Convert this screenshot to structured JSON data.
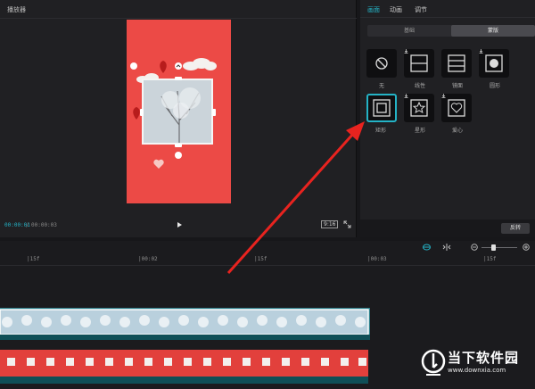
{
  "player": {
    "title": "播放器",
    "current_time": "00:00:01",
    "separator": "/",
    "total_time": "00:00:03",
    "ratio": "9:16"
  },
  "props": {
    "tabs": [
      {
        "label": "画面",
        "active": true
      },
      {
        "label": "动画",
        "active": false
      },
      {
        "label": "调节",
        "active": false
      }
    ],
    "segments": [
      {
        "label": "基础",
        "active": false
      },
      {
        "label": "蒙版",
        "active": true
      }
    ],
    "masks": [
      {
        "label": "无",
        "icon": "none-icon",
        "selected": false
      },
      {
        "label": "线性",
        "icon": "linear-mask-icon",
        "selected": false
      },
      {
        "label": "镜面",
        "icon": "mirror-mask-icon",
        "selected": false
      },
      {
        "label": "圆形",
        "icon": "circle-mask-icon",
        "selected": false
      },
      {
        "label": "矩形",
        "icon": "rect-mask-icon",
        "selected": true
      },
      {
        "label": "星形",
        "icon": "star-mask-icon",
        "selected": false
      },
      {
        "label": "爱心",
        "icon": "heart-mask-icon",
        "selected": false
      }
    ],
    "invert_label": "反转"
  },
  "timeline": {
    "ruler": [
      {
        "label": "|15f"
      },
      {
        "label": "|00:02"
      },
      {
        "label": "|15f"
      },
      {
        "label": "|00:03"
      },
      {
        "label": "|15f"
      }
    ]
  },
  "watermark": {
    "title": "当下软件园",
    "url": "www.downxia.com"
  },
  "colors": {
    "accent": "#24b3c6",
    "arrow": "#e8231f",
    "video_background": "#ec4a46"
  }
}
